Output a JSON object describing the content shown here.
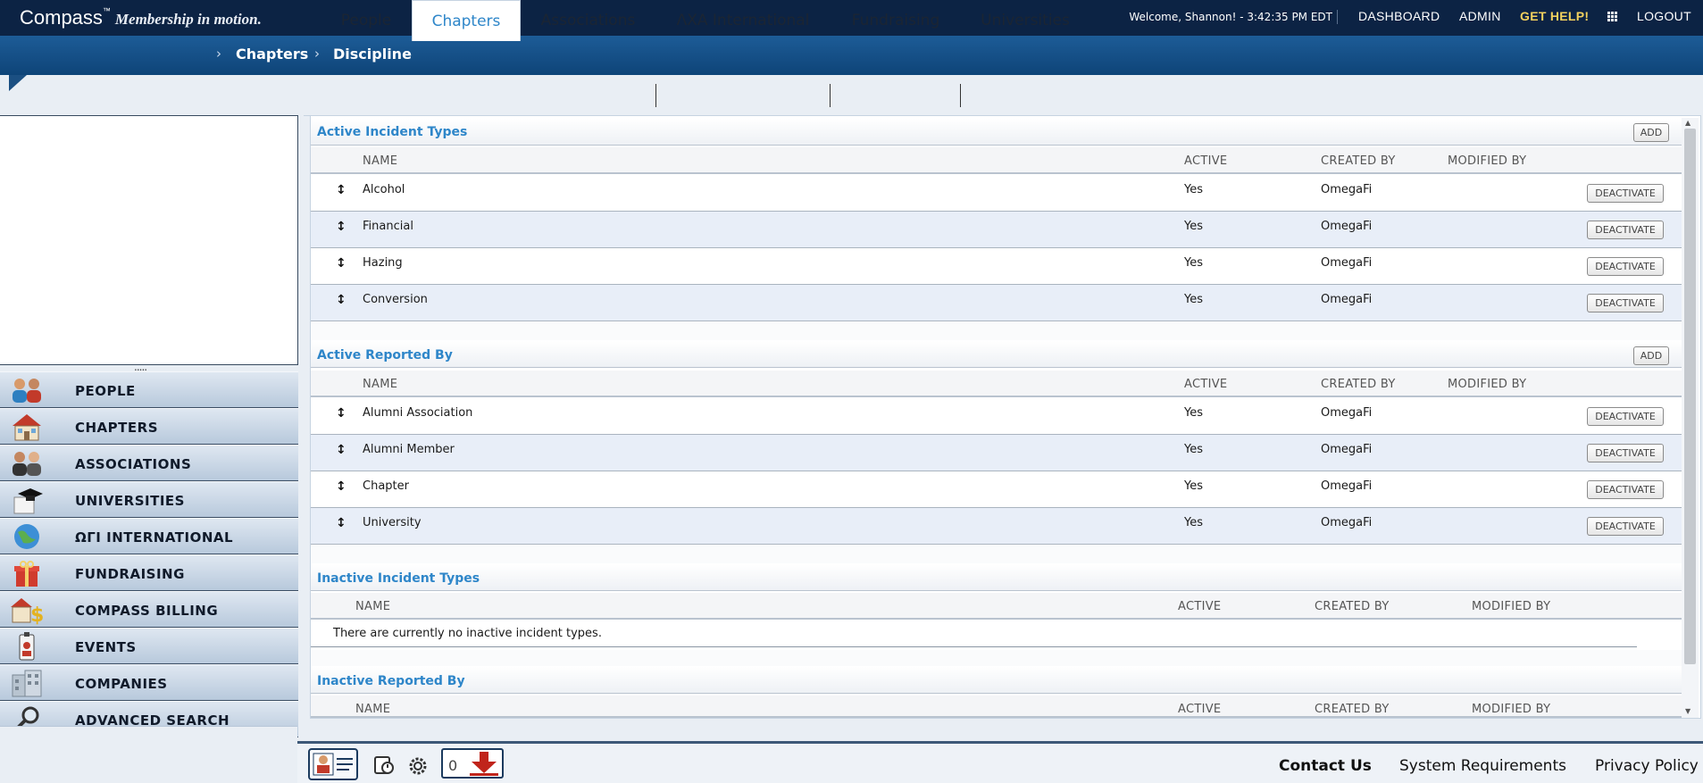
{
  "header": {
    "brand": "Compass",
    "brand_tm": "™",
    "tagline": "Membership in motion.",
    "welcome": "Welcome, Shannon! - 3:42:35 PM EDT",
    "nav": [
      "DASHBOARD",
      "ADMIN",
      "GET HELP!",
      "LOGOUT"
    ]
  },
  "breadcrumb": [
    "Chapters",
    "Discipline"
  ],
  "tabs": [
    "People",
    "Chapters",
    "Associations",
    "ΛXA International",
    "Fundraising",
    "Universities"
  ],
  "active_tab": "Chapters",
  "sidebar": {
    "grip": ".....",
    "items": [
      {
        "label": "PEOPLE",
        "icon": "people-icon"
      },
      {
        "label": "CHAPTERS",
        "icon": "house-icon"
      },
      {
        "label": "ASSOCIATIONS",
        "icon": "associations-icon"
      },
      {
        "label": "UNIVERSITIES",
        "icon": "graduation-cap-icon"
      },
      {
        "label": "ΩΓΙ INTERNATIONAL",
        "icon": "globe-icon"
      },
      {
        "label": "FUNDRAISING",
        "icon": "gift-icon"
      },
      {
        "label": "COMPASS BILLING",
        "icon": "billing-house-dollar-icon"
      },
      {
        "label": "EVENTS",
        "icon": "events-badge-icon"
      },
      {
        "label": "COMPANIES",
        "icon": "buildings-icon"
      },
      {
        "label": "ADVANCED SEARCH",
        "icon": "magnifier-icon"
      }
    ]
  },
  "columns": {
    "name": "NAME",
    "active": "ACTIVE",
    "created_by": "CREATED BY",
    "modified_by": "MODIFIED BY"
  },
  "buttons": {
    "add": "ADD",
    "deactivate": "DEACTIVATE"
  },
  "sections": {
    "active_incident": {
      "title": "Active Incident Types",
      "rows": [
        {
          "name": "Alcohol",
          "active": "Yes",
          "created_by": "OmegaFi",
          "modified_by": ""
        },
        {
          "name": "Financial",
          "active": "Yes",
          "created_by": "OmegaFi",
          "modified_by": ""
        },
        {
          "name": "Hazing",
          "active": "Yes",
          "created_by": "OmegaFi",
          "modified_by": ""
        },
        {
          "name": "Conversion",
          "active": "Yes",
          "created_by": "OmegaFi",
          "modified_by": ""
        }
      ]
    },
    "active_reported": {
      "title": "Active Reported By",
      "rows": [
        {
          "name": "Alumni Association",
          "active": "Yes",
          "created_by": "OmegaFi",
          "modified_by": ""
        },
        {
          "name": "Alumni Member",
          "active": "Yes",
          "created_by": "OmegaFi",
          "modified_by": ""
        },
        {
          "name": "Chapter",
          "active": "Yes",
          "created_by": "OmegaFi",
          "modified_by": ""
        },
        {
          "name": "University",
          "active": "Yes",
          "created_by": "OmegaFi",
          "modified_by": ""
        }
      ]
    },
    "inactive_incident": {
      "title": "Inactive Incident Types",
      "empty_message": "There are currently no inactive incident types."
    },
    "inactive_reported": {
      "title": "Inactive Reported By"
    }
  },
  "footer": {
    "counter": "0",
    "links": [
      "Contact Us",
      "System Requirements",
      "Privacy Policy"
    ]
  },
  "colors": {
    "header_bg": "#0c2344",
    "accent": "#2e86c9",
    "help": "#f4d25e",
    "alt_row": "#e8eef8"
  }
}
